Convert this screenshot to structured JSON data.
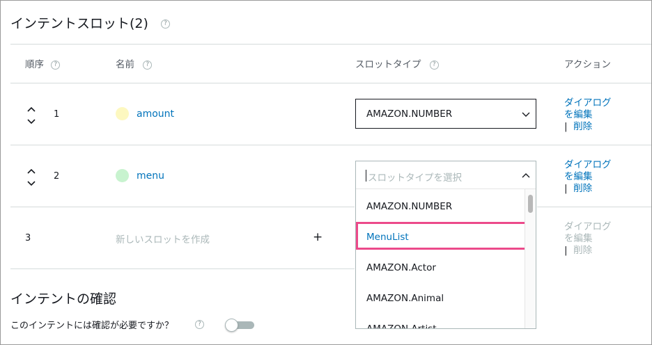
{
  "section_title": "インテントスロット(2)",
  "help_glyph": "?",
  "columns": {
    "order": "順序",
    "name": "名前",
    "slot_type": "スロットタイプ",
    "action": "アクション"
  },
  "rows": [
    {
      "order": "1",
      "name": "amount",
      "dot_color": "#fdf8c0",
      "slot_type": "AMAZON.NUMBER",
      "action_edit": "ダイアログ\nを編集",
      "action_delete": "削除"
    },
    {
      "order": "2",
      "name": "menu",
      "dot_color": "#c8f3cf",
      "slot_type_placeholder": "スロットタイプを選択",
      "action_edit": "ダイアログ\nを編集",
      "action_delete": "削除"
    },
    {
      "order": "3",
      "name_placeholder": "新しいスロットを作成",
      "add_glyph": "+",
      "action_edit": "ダイアログ\nを編集",
      "action_delete": "削除"
    }
  ],
  "dropdown": {
    "options": [
      "AMAZON.NUMBER",
      "MenuList",
      "AMAZON.Actor",
      "AMAZON.Animal",
      "AMAZON.Artist"
    ],
    "highlighted": "MenuList",
    "highlight_color": "#ec4a8a"
  },
  "confirm": {
    "title": "インテントの確認",
    "question": "このインテントには確認が必要ですか？",
    "toggle_on": false
  }
}
